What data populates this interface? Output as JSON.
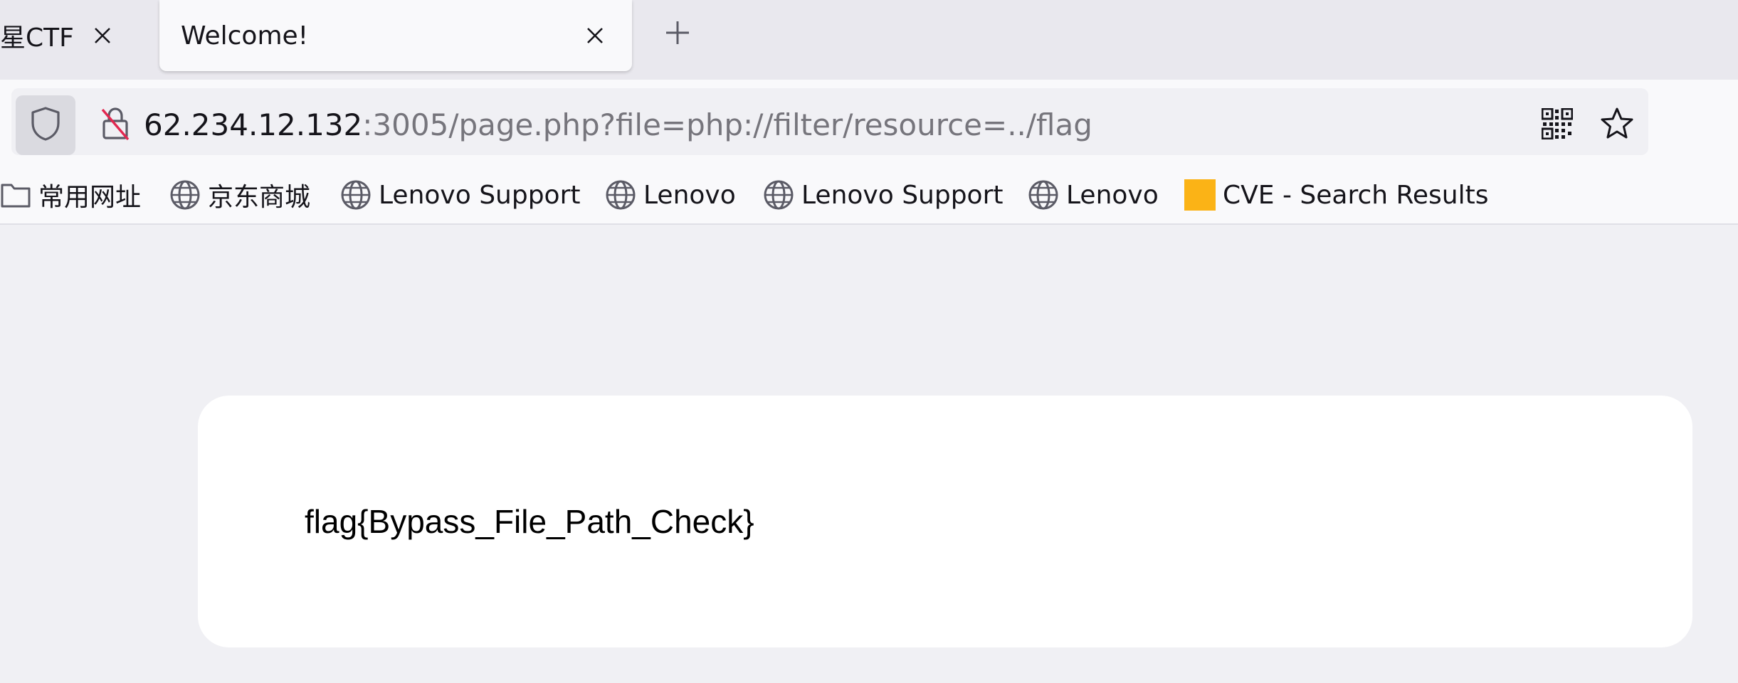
{
  "tabs": [
    {
      "title": "星CTF",
      "active": false
    },
    {
      "title": "Welcome!",
      "active": true
    }
  ],
  "url": {
    "host": "62.234.12.132",
    "rest": ":3005/page.php?file=php://filter/resource=../flag"
  },
  "bookmarks": [
    {
      "label": "常用网址",
      "icon": "folder-icon"
    },
    {
      "label": "京东商城",
      "icon": "globe-icon"
    },
    {
      "label": "Lenovo Support",
      "icon": "globe-icon"
    },
    {
      "label": "Lenovo",
      "icon": "globe-icon"
    },
    {
      "label": "Lenovo Support",
      "icon": "globe-icon"
    },
    {
      "label": "Lenovo",
      "icon": "globe-icon"
    },
    {
      "label": "CVE - Search Results",
      "icon": "cve-favicon",
      "color": "#fbb316"
    }
  ],
  "page": {
    "text": "flag{Bypass_File_Path_Check}"
  },
  "colors": {
    "accent_insecure": "#e22850",
    "cve_favicon": "#fbb316"
  }
}
